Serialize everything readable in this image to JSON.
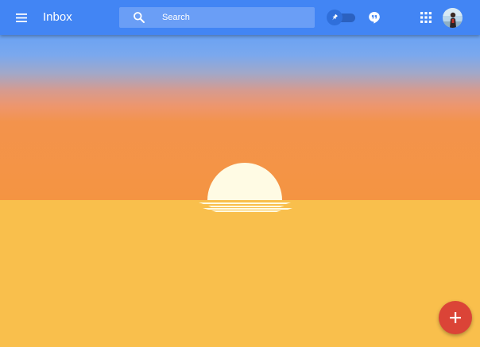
{
  "header": {
    "title": "Inbox",
    "menu_icon": "hamburger-menu-icon",
    "search": {
      "placeholder": "Search",
      "icon": "search-icon"
    },
    "pinned_toggle": {
      "icon": "pin-icon",
      "state": "off"
    },
    "hangouts_icon": "hangouts-icon",
    "apps_icon": "apps-grid-icon",
    "avatar_icon": "user-avatar"
  },
  "main": {
    "empty_state_illustration": "sunset"
  },
  "fab": {
    "icon": "plus-icon",
    "label": "+"
  },
  "colors": {
    "topbar": "#4285f4",
    "search_bg": "#6a9ef6",
    "sky_top": "#6aa2f3",
    "sky_bottom": "#f49442",
    "ground": "#f9bf4c",
    "sun": "#fffbe4",
    "fab": "#db4437"
  }
}
